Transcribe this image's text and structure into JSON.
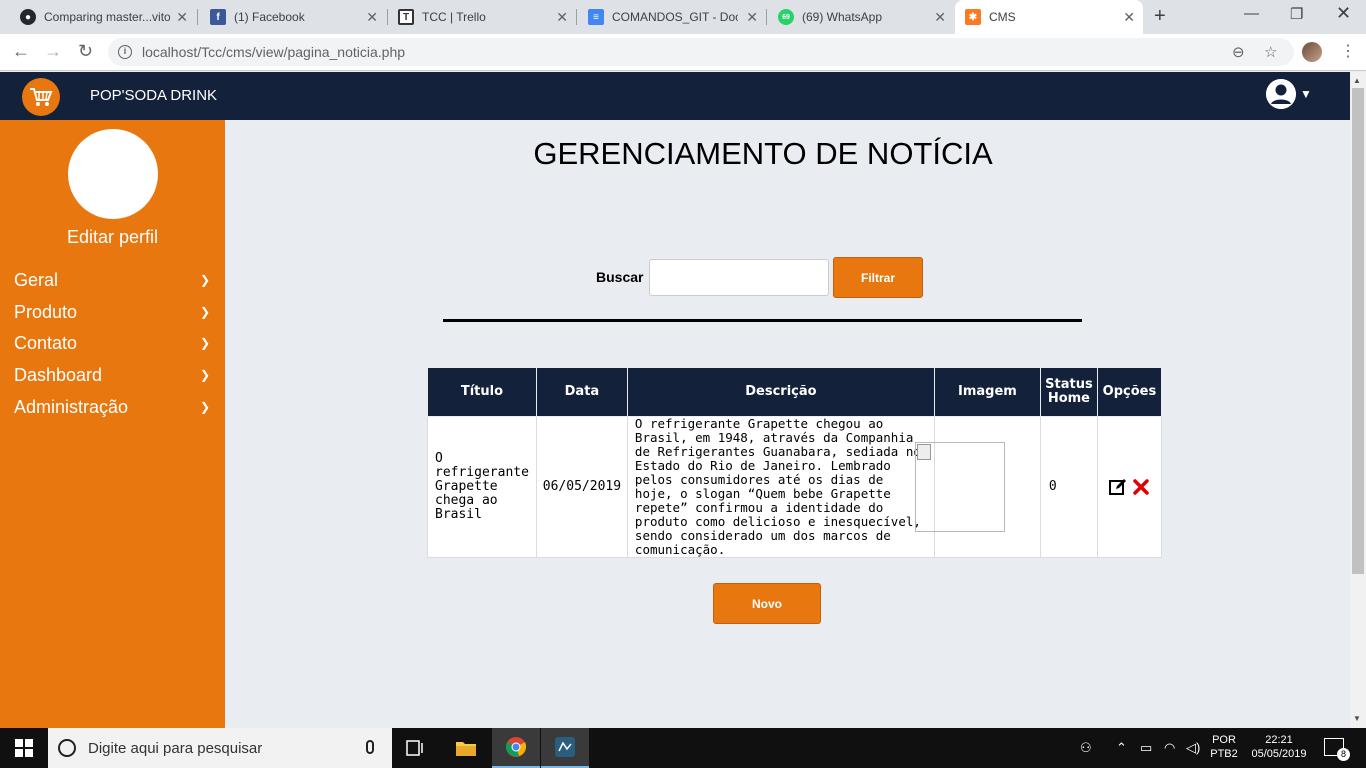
{
  "browser": {
    "tabs": [
      {
        "title": "Comparing master...vito",
        "icon": "github-icon"
      },
      {
        "title": "(1) Facebook",
        "icon": "facebook-icon"
      },
      {
        "title": "TCC | Trello",
        "icon": "trello-icon"
      },
      {
        "title": "COMANDOS_GIT - Doc",
        "icon": "google-docs-icon"
      },
      {
        "title": "(69) WhatsApp",
        "icon": "whatsapp-icon",
        "badge": "69"
      },
      {
        "title": "CMS",
        "icon": "xampp-icon",
        "active": true
      }
    ],
    "url": "localhost/Tcc/cms/view/pagina_noticia.php"
  },
  "header": {
    "brand": "POP'SODA DRINK"
  },
  "sidebar": {
    "edit_profile": "Editar perfil",
    "items": [
      {
        "label": "Geral"
      },
      {
        "label": "Produto"
      },
      {
        "label": "Contato"
      },
      {
        "label": "Dashboard"
      },
      {
        "label": "Administração"
      }
    ]
  },
  "main": {
    "title": "GERENCIAMENTO DE NOTÍCIA",
    "search": {
      "label": "Buscar",
      "value": "",
      "placeholder": "",
      "button": "Filtrar"
    },
    "table": {
      "columns": [
        "Título",
        "Data",
        "Descrição",
        "Imagem",
        "Status Home",
        "Opções"
      ],
      "rows": [
        {
          "titulo": "O refrigerante Grapette chega ao Brasil",
          "data": "06/05/2019",
          "descricao": "O refrigerante Grapette chegou ao Brasil, em 1948, através da Companhia de Refrigerantes Guanabara, sediada no Estado do Rio de Janeiro. Lembrado pelos consumidores até os dias de hoje, o slogan “Quem bebe Grapette repete” confirmou a identidade do produto como delicioso e inesquecível, sendo considerado um dos marcos de comunicação.",
          "status_home": "0"
        }
      ]
    },
    "new_button": "Novo"
  },
  "taskbar": {
    "search_placeholder": "Digite aqui para pesquisar",
    "lang": "POR",
    "layout": "PTB2",
    "time": "22:21",
    "date": "05/05/2019",
    "notifications": "8"
  },
  "colors": {
    "accent": "#e8770f",
    "navy": "#13213a",
    "background": "#e9ecf0"
  }
}
